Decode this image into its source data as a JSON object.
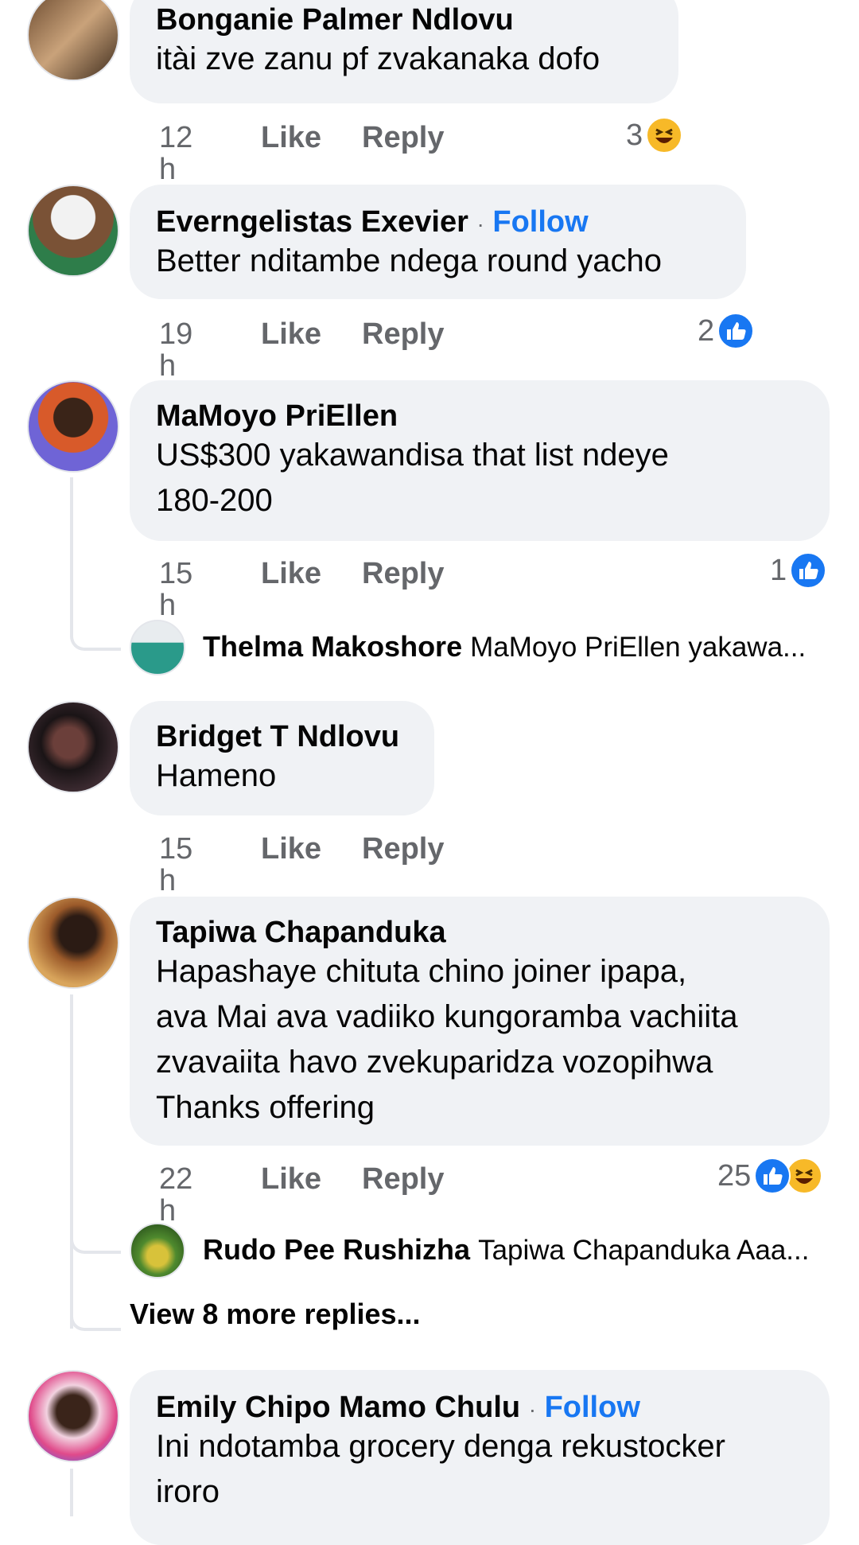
{
  "comments": [
    {
      "name": "Bonganie Palmer Ndlovu",
      "text": [
        "itài zve zanu pf zvakanaka dofo"
      ],
      "time": "12 h",
      "like": "Like",
      "reply": "Reply",
      "reaction_count": "3",
      "reactions": [
        "haha"
      ]
    },
    {
      "name": "Everngelistas Exevier",
      "follow": "Follow",
      "separator": "·",
      "text": [
        "Better nditambe ndega round yacho"
      ],
      "time": "19 h",
      "like": "Like",
      "reply": "Reply",
      "reaction_count": "2",
      "reactions": [
        "like"
      ]
    },
    {
      "name": "MaMoyo PriEllen",
      "text": [
        "US$300 yakawandisa that list ndeye",
        "180-200"
      ],
      "time": "15 h",
      "like": "Like",
      "reply": "Reply",
      "reaction_count": "1",
      "reactions": [
        "like"
      ],
      "reply_preview": {
        "name": "Thelma Makoshore",
        "text": "MaMoyo PriEllen yakawa..."
      }
    },
    {
      "name": "Bridget T Ndlovu",
      "text": [
        "Hameno"
      ],
      "time": "15 h",
      "like": "Like",
      "reply": "Reply"
    },
    {
      "name": "Tapiwa Chapanduka",
      "text": [
        "Hapashaye chituta chino joiner ipapa,",
        "ava Mai ava vadiiko kungoramba vachiita",
        "zvavaiita havo zvekuparidza vozopihwa",
        "Thanks offering"
      ],
      "time": "22 h",
      "like": "Like",
      "reply": "Reply",
      "reaction_count": "25",
      "reactions": [
        "like",
        "haha"
      ],
      "reply_preview": {
        "name": "Rudo Pee Rushizha",
        "text": "Tapiwa Chapanduka Aaa..."
      },
      "view_more": "View 8 more replies..."
    },
    {
      "name": "Emily Chipo Mamo Chulu",
      "follow": "Follow",
      "separator": "·",
      "text": [
        "Ini ndotamba grocery denga rekustocker",
        "iroro"
      ]
    }
  ],
  "colors": {
    "bubble": "#f0f2f5",
    "meta": "#65676b",
    "link": "#1877f2",
    "like_reaction": "#1877f2",
    "haha_reaction": "#f7b928"
  }
}
